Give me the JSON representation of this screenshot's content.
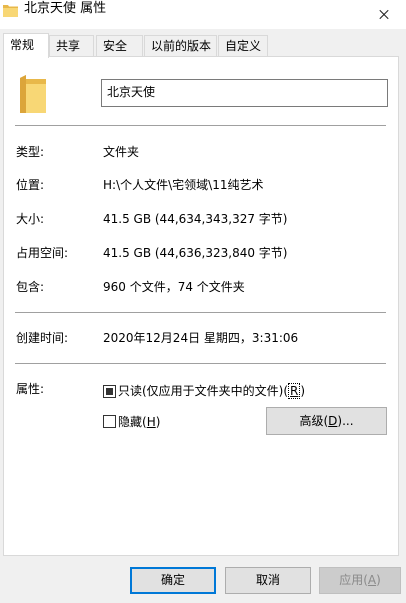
{
  "window": {
    "title": "北京天使 属性"
  },
  "tabs": [
    "常规",
    "共享",
    "安全",
    "以前的版本",
    "自定义"
  ],
  "general": {
    "folder_name": "北京天使",
    "rows": [
      {
        "label": "类型:",
        "value": "文件夹"
      },
      {
        "label": "位置:",
        "value": "H:\\个人文件\\宅领域\\11纯艺术"
      },
      {
        "label": "大小:",
        "value": "41.5 GB (44,634,343,327 字节)"
      },
      {
        "label": "占用空间:",
        "value": "41.5 GB (44,636,323,840 字节)"
      },
      {
        "label": "包含:",
        "value": "960 个文件，74 个文件夹"
      }
    ],
    "created": {
      "label": "创建时间:",
      "value": "2020年12月24日 星期四，3:31:06"
    },
    "attributes": {
      "label": "属性:",
      "readonly_text": "只读(仅应用于文件夹中的文件)(",
      "readonly_key": "R",
      "readonly_close": ")",
      "hidden_text": "隐藏(",
      "hidden_key": "H",
      "hidden_close": ")",
      "advanced_text": "高级(",
      "advanced_key": "D",
      "advanced_close": ")..."
    }
  },
  "buttons": {
    "ok": "确定",
    "cancel": "取消",
    "apply_text": "应用(",
    "apply_key": "A",
    "apply_close": ")"
  },
  "colors": {
    "folder": "#f8d775",
    "folder_dark": "#e8b84a",
    "accent": "#0078d7"
  }
}
